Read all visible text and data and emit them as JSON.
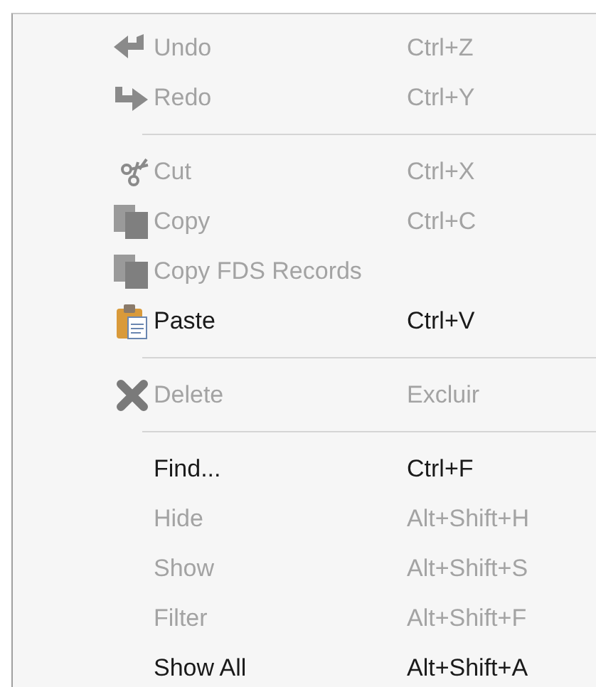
{
  "menu": {
    "items": [
      {
        "kind": "item",
        "label": "Undo",
        "shortcut": "Ctrl+Z",
        "disabled": true
      },
      {
        "kind": "item",
        "label": "Redo",
        "shortcut": "Ctrl+Y",
        "disabled": true
      },
      {
        "kind": "separator"
      },
      {
        "kind": "item",
        "label": "Cut",
        "shortcut": "Ctrl+X",
        "disabled": true
      },
      {
        "kind": "item",
        "label": "Copy",
        "shortcut": "Ctrl+C",
        "disabled": true
      },
      {
        "kind": "item",
        "label": "Copy FDS Records",
        "disabled": true
      },
      {
        "kind": "item",
        "label": "Paste",
        "shortcut": "Ctrl+V",
        "disabled": false
      },
      {
        "kind": "separator"
      },
      {
        "kind": "item",
        "label": "Delete",
        "shortcut": "Excluir",
        "disabled": true
      },
      {
        "kind": "separator"
      },
      {
        "kind": "item",
        "label": "Find...",
        "shortcut": "Ctrl+F",
        "disabled": false
      },
      {
        "kind": "item",
        "label": "Hide",
        "shortcut": "Alt+Shift+H",
        "disabled": true
      },
      {
        "kind": "item",
        "label": "Show",
        "shortcut": "Alt+Shift+S",
        "disabled": true
      },
      {
        "kind": "item",
        "label": "Filter",
        "shortcut": "Alt+Shift+F",
        "disabled": true
      },
      {
        "kind": "item",
        "label": "Show All",
        "shortcut": "Alt+Shift+A",
        "disabled": false
      }
    ]
  }
}
